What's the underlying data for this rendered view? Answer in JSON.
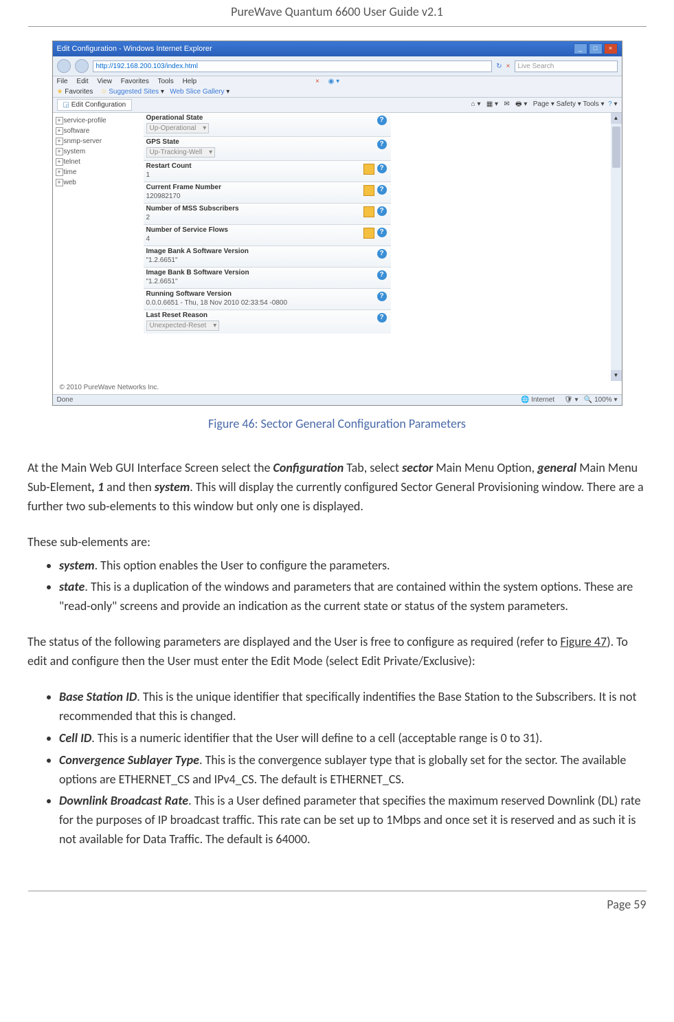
{
  "doc_title": "PureWave Quantum 6600 User Guide v2.1",
  "page_number": "Page 59",
  "figure_caption": "Figure 46: Sector General Configuration Parameters",
  "browser": {
    "window_title": "Edit Configuration - Windows Internet Explorer",
    "url": "http://192.168.200.103/index.html",
    "search_placeholder": "Live Search",
    "menu": [
      "File",
      "Edit",
      "View",
      "Favorites",
      "Tools",
      "Help"
    ],
    "fav_label": "Favorites",
    "suggested_label": "Suggested Sites",
    "webslice_label": "Web Slice Gallery",
    "tab_title": "Edit Configuration",
    "toolbar_right": "Page ▾   Safety ▾   Tools ▾",
    "status_done": "Done",
    "status_zone": "Internet",
    "status_zoom": "100%"
  },
  "tree": {
    "items": [
      "service-profile",
      "software",
      "snmp-server",
      "system",
      "telnet",
      "time",
      "web"
    ]
  },
  "form": {
    "rows": [
      {
        "label": "Operational State",
        "value": "Up-Operational",
        "select": true,
        "chart": false
      },
      {
        "label": "GPS State",
        "value": "Up-Tracking-Well",
        "select": true,
        "chart": false
      },
      {
        "label": "Restart Count",
        "value": "1",
        "select": false,
        "chart": true
      },
      {
        "label": "Current Frame Number",
        "value": "120982170",
        "select": false,
        "chart": true
      },
      {
        "label": "Number of MSS Subscribers",
        "value": "2",
        "select": false,
        "chart": true
      },
      {
        "label": "Number of Service Flows",
        "value": "4",
        "select": false,
        "chart": true
      },
      {
        "label": "Image Bank A Software Version",
        "value": "\"1.2.6651\"",
        "select": false,
        "chart": false
      },
      {
        "label": "Image Bank B Software Version",
        "value": "\"1.2.6651\"",
        "select": false,
        "chart": false
      },
      {
        "label": "Running Software Version",
        "value": "0.0.0.6651 - Thu, 18 Nov 2010 02:33:54 -0800",
        "select": false,
        "chart": false
      },
      {
        "label": "Last Reset Reason",
        "value": "Unexpected-Reset",
        "select": true,
        "chart": false
      }
    ]
  },
  "copyright": "© 2010 PureWave Networks Inc.",
  "para1_pre": "At the Main Web GUI Interface Screen select the ",
  "para1_b1": "Configuration",
  "para1_mid1": " Tab, select ",
  "para1_b2": "sector",
  "para1_mid2": " Main Menu Option, ",
  "para1_b3": "general",
  "para1_mid3": " Main Menu Sub-Element",
  "para1_b4": ", 1",
  "para1_mid4": " and then ",
  "para1_b5": "system",
  "para1_post": ". This will display the currently configured Sector General Provisioning window. There are a further two sub-elements to this window but only one is displayed.",
  "para2": "These sub-elements are:",
  "li1_b": "system",
  "li1_t": ". This option enables the User to configure the parameters.",
  "li2_b": "state",
  "li2_t": ". This is a duplication of the windows and parameters that are contained within the system options. These are \"read-only\" screens and provide an indication as the current state or status of the system parameters.",
  "para3_pre": "The status of the following parameters are displayed and the User is free to configure as required (refer to ",
  "para3_link": "Figure 47",
  "para3_post": "). To edit and configure then the User must enter the Edit Mode (select Edit Private/Exclusive):",
  "bi1_b": "Base Station ID",
  "bi1_t": ". This is the unique identifier that specifically indentifies the Base Station to the Subscribers. It is not recommended that this is changed.",
  "bi2_b": "Cell ID",
  "bi2_t": ". This is a numeric identifier that the User will define to a cell (acceptable range is 0 to 31).",
  "bi3_b": "Convergence Sublayer Type",
  "bi3_t": ". This is the convergence sublayer type that is globally set for the sector.  The available options are ETHERNET_CS and IPv4_CS. The default is ETHERNET_CS.",
  "bi4_b": "Downlink Broadcast Rate",
  "bi4_t": ". This is a User defined parameter that specifies the maximum reserved Downlink (DL) rate for the purposes of IP broadcast traffic. This rate can be set up to 1Mbps and once set it is reserved and as such it is not available for Data Traffic. The default is 64000."
}
